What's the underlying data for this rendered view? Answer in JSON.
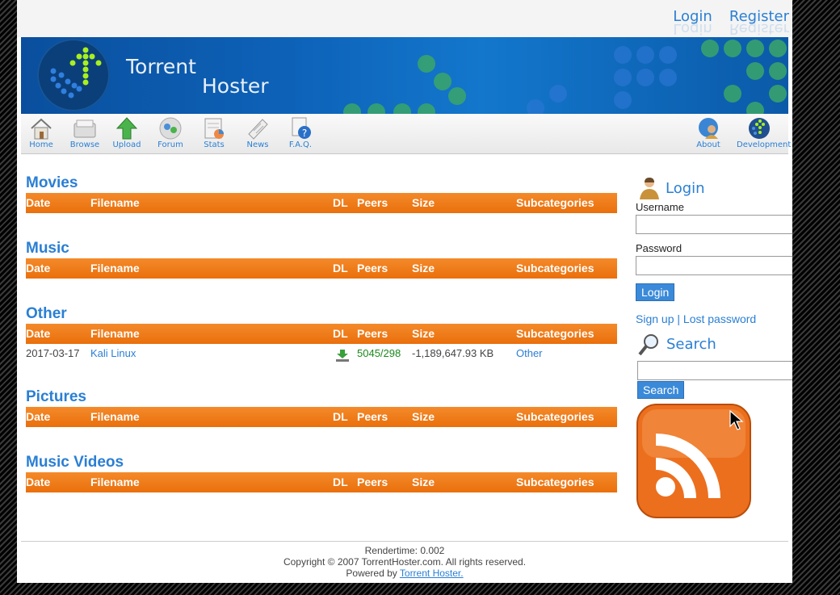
{
  "toplinks": {
    "login": "Login",
    "register": "Register"
  },
  "banner": {
    "brand_line1": "Torrent",
    "brand_line2": "Hoster"
  },
  "nav": {
    "left": [
      {
        "label": "Home",
        "icon": "home-icon"
      },
      {
        "label": "Browse",
        "icon": "browse-icon"
      },
      {
        "label": "Upload",
        "icon": "upload-icon"
      },
      {
        "label": "Forum",
        "icon": "forum-icon"
      },
      {
        "label": "Stats",
        "icon": "stats-icon"
      },
      {
        "label": "News",
        "icon": "news-icon"
      },
      {
        "label": "F.A.Q.",
        "icon": "faq-icon"
      }
    ],
    "right": [
      {
        "label": "About",
        "icon": "about-icon"
      },
      {
        "label": "Development",
        "icon": "development-icon"
      }
    ]
  },
  "columns": {
    "date": "Date",
    "filename": "Filename",
    "dl": "DL",
    "peers": "Peers",
    "size": "Size",
    "subcategories": "Subcategories"
  },
  "categories": [
    {
      "title": "Movies",
      "rows": []
    },
    {
      "title": "Music",
      "rows": []
    },
    {
      "title": "Other",
      "rows": [
        {
          "date": "2017-03-17",
          "filename": "Kali Linux",
          "peers": "5045/298",
          "size": "-1,189,647.93 KB",
          "subcategory": "Other"
        }
      ]
    },
    {
      "title": "Pictures",
      "rows": []
    },
    {
      "title": "Music Videos",
      "rows": []
    }
  ],
  "sidebar": {
    "login_title": "Login",
    "username_label": "Username",
    "password_label": "Password",
    "login_button": "Login",
    "signup": "Sign up",
    "separator": "|",
    "lost_password": "Lost password",
    "search_title": "Search",
    "search_button": "Search"
  },
  "footer": {
    "rendertime": "Rendertime: 0.002",
    "copyright": "Copyright © 2007 TorrentHoster.com. All rights reserved.",
    "powered_prefix": "Powered by",
    "powered_link": "Torrent Hoster."
  },
  "colors": {
    "accent": "#2a7fd4",
    "header_orange": "#ee7716",
    "rss_orange": "#ec6f1e"
  }
}
